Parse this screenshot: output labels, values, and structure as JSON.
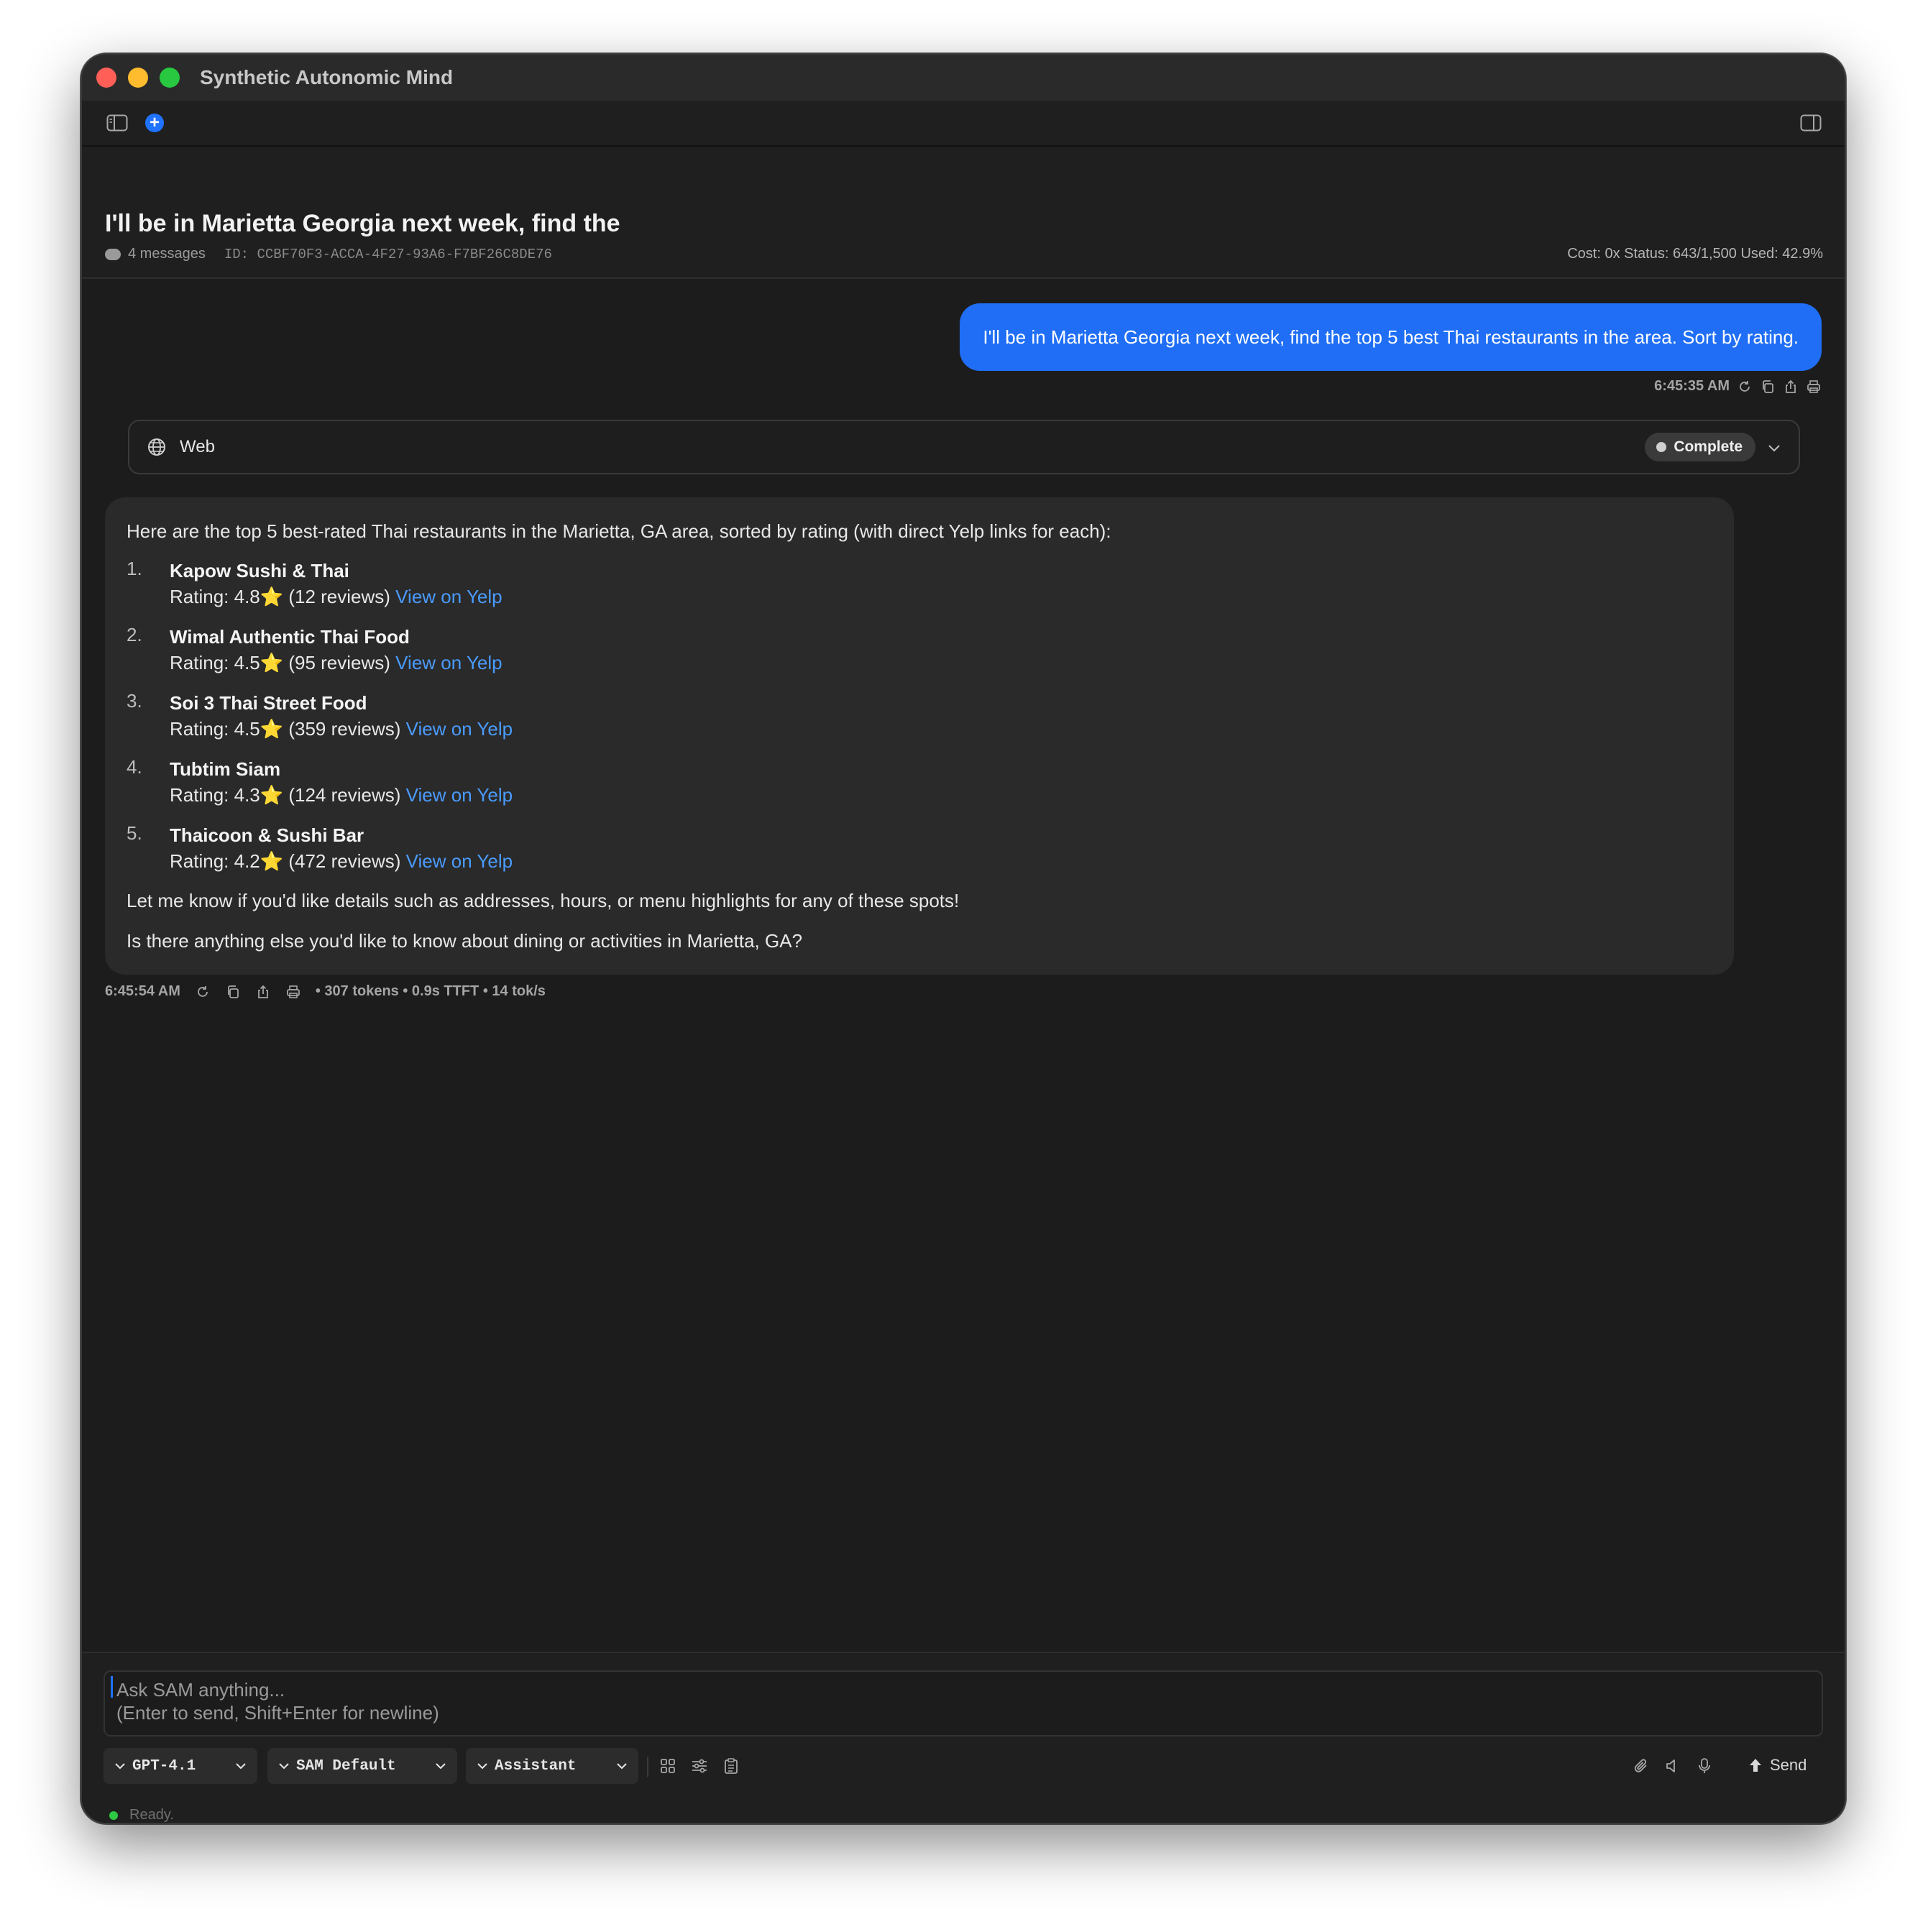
{
  "window": {
    "title": "Synthetic Autonomic Mind"
  },
  "toolbar": {
    "sidebar_icon": "sidebar-toggle-icon",
    "new_chat_icon": "plus-circle-icon",
    "inspector_icon": "inspector-toggle-icon"
  },
  "conversation": {
    "title": "I'll be in Marietta Georgia next week, find the",
    "message_count": "4 messages",
    "id": "ID: CCBF70F3-ACCA-4F27-93A6-F7BF26C8DE76",
    "stats": "Cost: 0x  Status: 643/1,500  Used: 42.9%"
  },
  "user_message": {
    "text": "I'll be in Marietta Georgia next week, find the top 5 best Thai restaurants in the area.  Sort by rating.",
    "time": "6:45:35 AM"
  },
  "tool_call": {
    "label": "Web",
    "status": "Complete"
  },
  "assistant_message": {
    "intro": "Here are the top 5 best-rated Thai restaurants in the Marietta, GA area, sorted by rating (with direct Yelp links for each):",
    "items": [
      {
        "num": "1.",
        "name": "Kapow Sushi & Thai",
        "rating_prefix": "Rating: 4.8",
        "star": "⭐",
        "reviews": " (12 reviews) ",
        "link": "View on Yelp"
      },
      {
        "num": "2.",
        "name": "Wimal Authentic Thai Food",
        "rating_prefix": "Rating: 4.5",
        "star": "⭐",
        "reviews": " (95 reviews) ",
        "link": "View on Yelp"
      },
      {
        "num": "3.",
        "name": "Soi 3 Thai Street Food",
        "rating_prefix": "Rating: 4.5",
        "star": "⭐",
        "reviews": " (359 reviews) ",
        "link": "View on Yelp"
      },
      {
        "num": "4.",
        "name": "Tubtim Siam",
        "rating_prefix": "Rating: 4.3",
        "star": "⭐",
        "reviews": " (124 reviews) ",
        "link": "View on Yelp"
      },
      {
        "num": "5.",
        "name": "Thaicoon & Sushi Bar",
        "rating_prefix": "Rating: 4.2",
        "star": "⭐",
        "reviews": " (472 reviews) ",
        "link": "View on Yelp"
      }
    ],
    "outro1": "Let me know if you'd like details such as addresses, hours, or menu highlights for any of these spots!",
    "outro2": "Is there anything else you'd like to know about dining or activities in Marietta, GA?",
    "time": "6:45:54 AM",
    "metrics": "• 307 tokens • 0.9s TTFT • 14 tok/s"
  },
  "composer": {
    "placeholder_line1": "Ask SAM anything...",
    "placeholder_line2": "(Enter to send, Shift+Enter for newline)",
    "model": "GPT-4.1",
    "system_prompt": "SAM Default",
    "persona": "Assistant",
    "send_label": "Send"
  },
  "status_bar": {
    "text": "Ready."
  },
  "colors": {
    "accent": "#1f6ef5",
    "link": "#4a9bff",
    "background": "#1c1c1c",
    "card": "#2a2a2a",
    "star": "#f5b623",
    "ready": "#2ec845"
  }
}
